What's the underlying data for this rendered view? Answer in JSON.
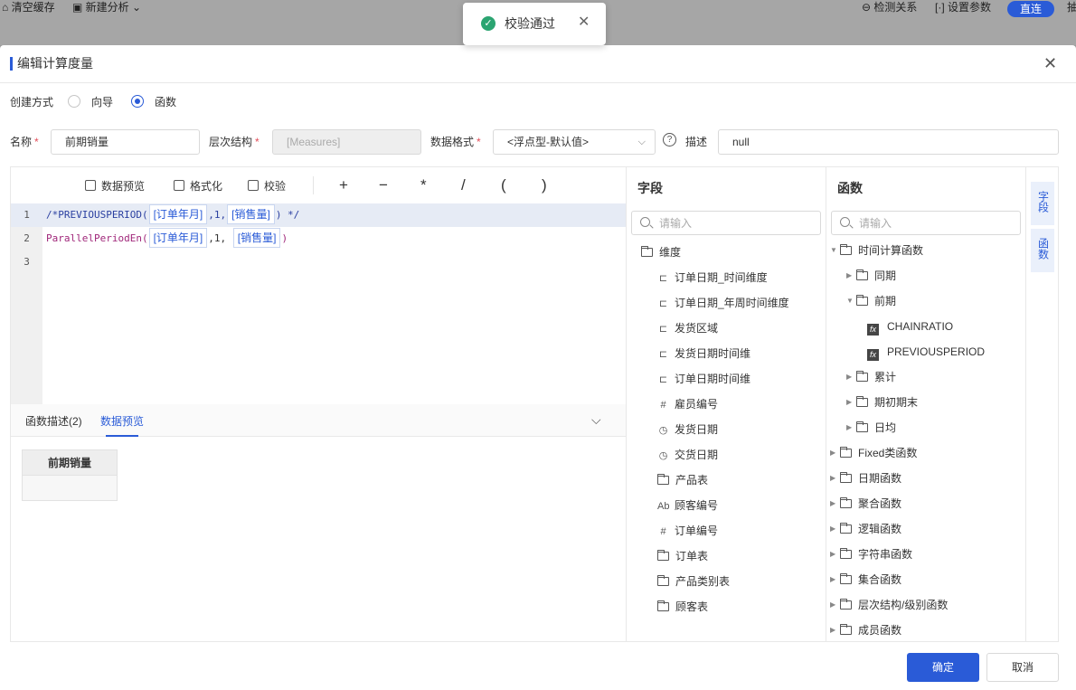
{
  "background": {
    "clear_cache": "清空缓存",
    "new_analysis": "新建分析",
    "detect_relation": "检测关系",
    "set_params": "设置参数",
    "direct_connect": "直连",
    "edge_char": "抽"
  },
  "toast": {
    "text": "校验通过"
  },
  "dialog": {
    "title": "编辑计算度量",
    "create_mode_label": "创建方式",
    "mode_guide": "向导",
    "mode_function": "函数",
    "selected_mode": "函数",
    "name_label": "名称",
    "name_value": "前期销量",
    "hierarchy_label": "层次结构",
    "hierarchy_value": "[Measures]",
    "format_label": "数据格式",
    "format_value": "<浮点型-默认值>",
    "desc_label": "描述",
    "desc_value": "null",
    "required_mark": "*"
  },
  "toolbar": {
    "preview": "数据预览",
    "format": "格式化",
    "validate": "校验",
    "op_plus": "+",
    "op_minus": "−",
    "op_mul": "*",
    "op_div": "/",
    "op_lparen": "(",
    "op_rparen": ")"
  },
  "code": {
    "line_numbers": [
      "1",
      "2",
      "3"
    ],
    "line1": {
      "fn": "/*PREVIOUSPERIOD(",
      "tok1": "[订单年月]",
      "mid": ",1,",
      "tok2": "[销售量]",
      "end": ") */"
    },
    "line2": {
      "fn": "ParallelPeriodEn(",
      "tok1": "[订单年月]",
      "mid": ",1, ",
      "tok2": "[销售量]",
      "end": ")"
    }
  },
  "bottom": {
    "tab_desc": "函数描述(2)",
    "tab_preview": "数据预览",
    "active_tab": "数据预览",
    "table_header": "前期销量"
  },
  "fields": {
    "title": "字段",
    "search_placeholder": "请输入",
    "root": "维度",
    "items": [
      {
        "label": "订单日期_时间维度",
        "icon": "hierarchy-icon"
      },
      {
        "label": "订单日期_年周时间维度",
        "icon": "hierarchy-icon"
      },
      {
        "label": "发货区域",
        "icon": "hierarchy-icon"
      },
      {
        "label": "发货日期时间维",
        "icon": "hierarchy-icon"
      },
      {
        "label": "订单日期时间维",
        "icon": "hierarchy-icon"
      },
      {
        "label": "雇员编号",
        "icon": "number-icon"
      },
      {
        "label": "发货日期",
        "icon": "date-icon"
      },
      {
        "label": "交货日期",
        "icon": "date-icon"
      },
      {
        "label": "产品表",
        "icon": "folder-icon"
      },
      {
        "label": "顾客编号",
        "icon": "text-icon"
      },
      {
        "label": "订单编号",
        "icon": "number-icon"
      },
      {
        "label": "订单表",
        "icon": "folder-icon"
      },
      {
        "label": "产品类别表",
        "icon": "folder-icon"
      },
      {
        "label": "顾客表",
        "icon": "folder-icon"
      }
    ]
  },
  "functions": {
    "title": "函数",
    "search_placeholder": "请输入",
    "items": [
      {
        "label": "时间计算函数",
        "kind": "folder",
        "caret": "▼"
      },
      {
        "label": "同期",
        "kind": "folder",
        "caret": "▶"
      },
      {
        "label": "前期",
        "kind": "folder",
        "caret": "▼"
      },
      {
        "label": "CHAINRATIO",
        "kind": "fx"
      },
      {
        "label": "PREVIOUSPERIOD",
        "kind": "fx"
      },
      {
        "label": "累计",
        "kind": "folder",
        "caret": "▶"
      },
      {
        "label": "期初期末",
        "kind": "folder",
        "caret": "▶"
      },
      {
        "label": "日均",
        "kind": "folder",
        "caret": "▶"
      },
      {
        "label": "Fixed类函数",
        "kind": "folder",
        "caret": "▶"
      },
      {
        "label": "日期函数",
        "kind": "folder",
        "caret": "▶"
      },
      {
        "label": "聚合函数",
        "kind": "folder",
        "caret": "▶"
      },
      {
        "label": "逻辑函数",
        "kind": "folder",
        "caret": "▶"
      },
      {
        "label": "字符串函数",
        "kind": "folder",
        "caret": "▶"
      },
      {
        "label": "集合函数",
        "kind": "folder",
        "caret": "▶"
      },
      {
        "label": "层次结构/级别函数",
        "kind": "folder",
        "caret": "▶"
      },
      {
        "label": "成员函数",
        "kind": "folder",
        "caret": "▶"
      }
    ]
  },
  "side_tabs": {
    "fields": "字段",
    "functions": "函数"
  },
  "footer": {
    "confirm": "确定",
    "cancel": "取消"
  },
  "colors": {
    "accent": "#2a5bd7",
    "success": "#2ba471",
    "required": "#e34d59"
  }
}
